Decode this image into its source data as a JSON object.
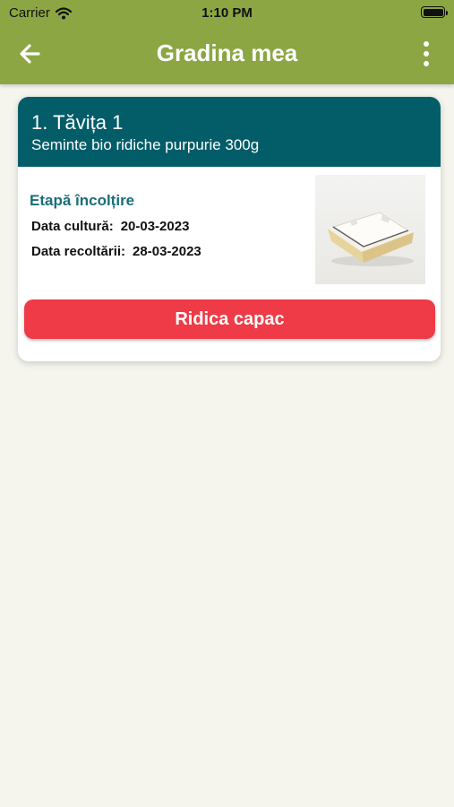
{
  "status_bar": {
    "carrier": "Carrier",
    "time": "1:10 PM"
  },
  "header": {
    "title": "Gradina mea",
    "back_icon": "arrow-left-icon",
    "menu_icon": "more-vertical-icon"
  },
  "tray": {
    "title": "1. Tăvița 1",
    "seed": "Seminte bio ridiche purpurie 300g",
    "stage": "Etapă încolțire",
    "culture_label": "Data cultură:",
    "culture_date": "20-03-2023",
    "harvest_label": "Data recoltării:",
    "harvest_date": "28-03-2023",
    "action_label": "Ridica capac"
  },
  "colors": {
    "header": "#8ba643",
    "card_header": "#035d68",
    "stage_text": "#1a6e79",
    "action_button": "#ef3b47",
    "background": "#f5f5ee"
  }
}
